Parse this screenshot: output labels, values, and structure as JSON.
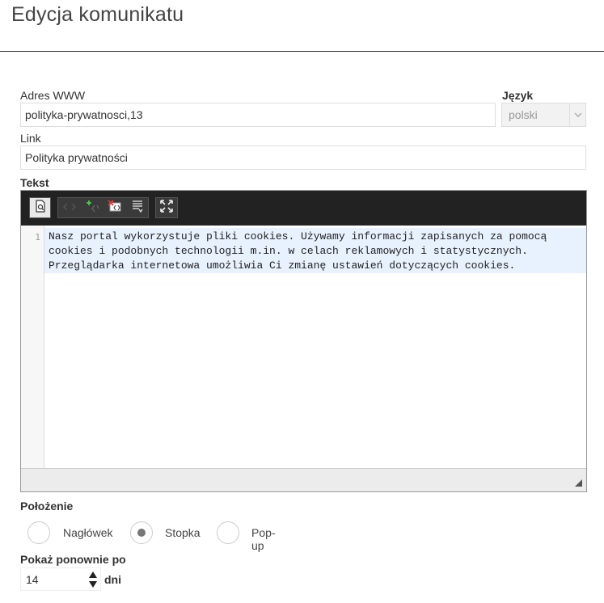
{
  "page": {
    "title": "Edycja komunikatu"
  },
  "form": {
    "url": {
      "label": "Adres WWW",
      "value": "polityka-prywatnosci,13"
    },
    "language": {
      "label": "Język",
      "value": "polski"
    },
    "link": {
      "label": "Link",
      "value": "Polityka prywatności"
    },
    "text": {
      "label": "Tekst",
      "line_number": "1",
      "lines": [
        "Nasz portal wykorzystuje pliki cookies. Używamy informacji zapisanych za pomocą",
        "cookies i podobnych technologii m.in. w celach reklamowych i statystycznych.",
        "Przeglądarka internetowa umożliwia Ci zmianę ustawień dotyczących cookies."
      ]
    },
    "position": {
      "label": "Położenie",
      "options": [
        {
          "label": "Nagłówek",
          "selected": false
        },
        {
          "label": "Stopka",
          "selected": true
        },
        {
          "label": "Pop-up",
          "selected": false
        }
      ]
    },
    "show_again": {
      "label": "Pokaż ponownie po",
      "value": "14",
      "unit": "dni"
    }
  },
  "toolbar": {
    "icons": [
      "preview-icon",
      "code-tag-icon",
      "add-code-icon",
      "clear-format-icon",
      "list-format-icon",
      "fullscreen-icon"
    ]
  },
  "colors": {
    "toolbar_bg": "#222222",
    "code_highlight": "#e8f2fe",
    "radio_dot": "#777777"
  }
}
